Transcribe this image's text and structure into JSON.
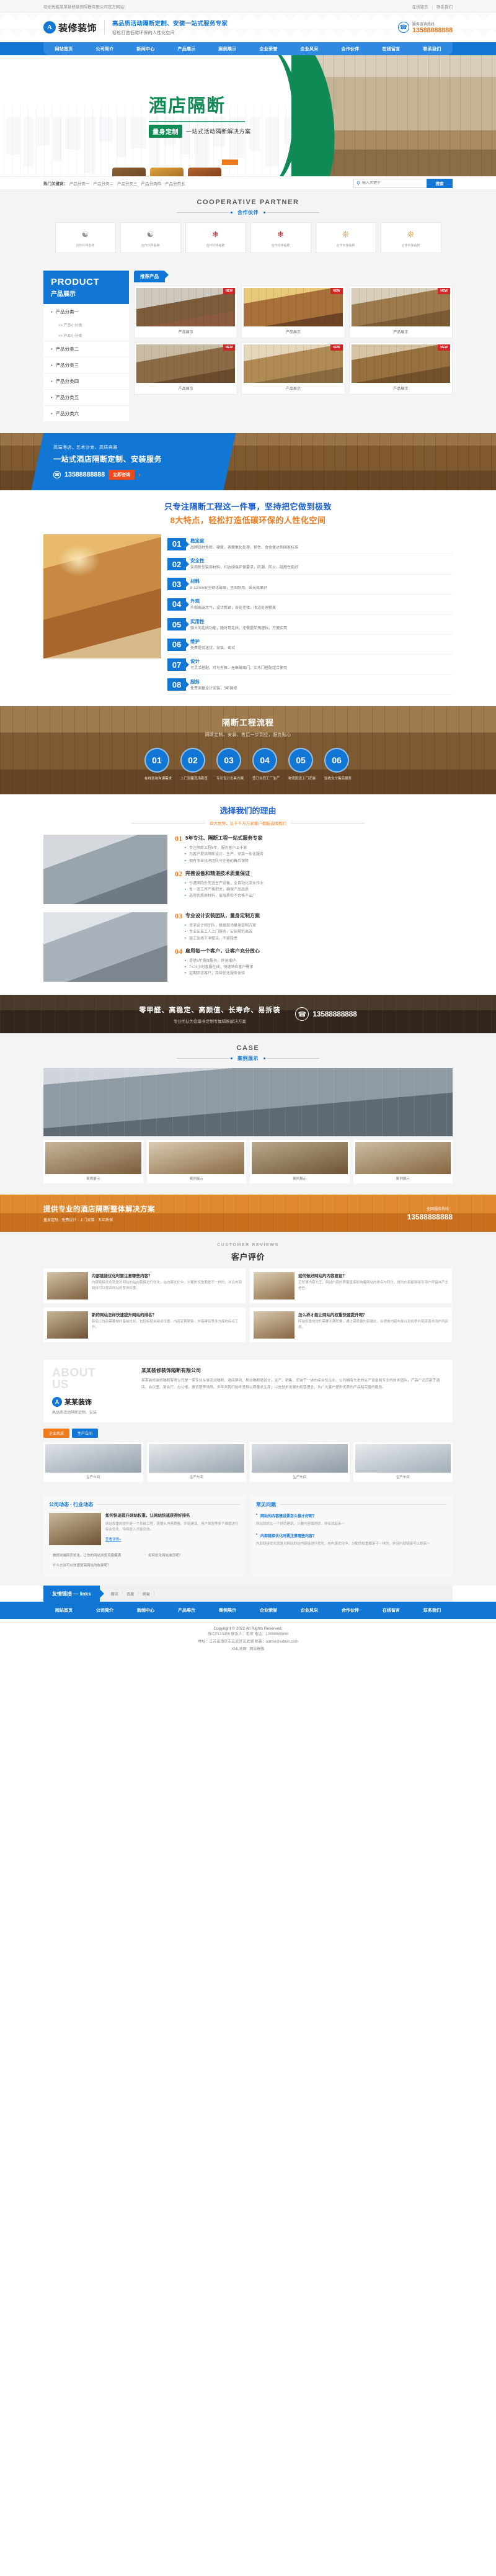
{
  "topbar": {
    "welcome": "欢迎光临某某装修装饰隔断有限公司官方网站！",
    "links": [
      {
        "label": "在线留言"
      },
      {
        "label": "联系我们"
      }
    ],
    "separator": "|"
  },
  "header": {
    "logo_mark": "A",
    "logo_text": "装修装饰",
    "slogan_main": "高品质活动隔断定制、安装一站式服务专家",
    "slogan_sub": "轻松打造低碳环保的人性化空间",
    "tel_label": "服务咨询热线",
    "tel_number": "13588888888",
    "phone_icon": "phone-icon",
    "accent_blue": "#1277d4",
    "accent_orange": "#ef7b1c"
  },
  "nav": {
    "items": [
      {
        "label": "网站首页"
      },
      {
        "label": "公司简介"
      },
      {
        "label": "新闻中心"
      },
      {
        "label": "产品展示"
      },
      {
        "label": "案例展示"
      },
      {
        "label": "企业荣誉"
      },
      {
        "label": "企业风采"
      },
      {
        "label": "合作伙伴"
      },
      {
        "label": "在线留言"
      },
      {
        "label": "联系我们"
      }
    ]
  },
  "hero": {
    "title": "酒店隔断",
    "badge": "量身定制",
    "subtitle": "一站式活动隔断解决方案",
    "accent_green": "#0f8a54"
  },
  "search": {
    "keywords_label": "热门关键词：",
    "keywords": [
      {
        "label": "产品分类一"
      },
      {
        "label": "产品分类二"
      },
      {
        "label": "产品分类三"
      },
      {
        "label": "产品分类四"
      },
      {
        "label": "产品分类五"
      }
    ],
    "placeholder": "输入关键字",
    "value": "",
    "button": "搜索",
    "search_icon": "search-icon"
  },
  "partners": {
    "en": "COOPERATIVE PARTNER",
    "cn": "合作伙伴",
    "items": [
      {
        "name": "合作伙伴名称",
        "mark": "gray"
      },
      {
        "name": "合作伙伴名称",
        "mark": "gray"
      },
      {
        "name": "合作伙伴名称",
        "mark": "red"
      },
      {
        "name": "合作伙伴名称",
        "mark": "red"
      },
      {
        "name": "合作伙伴名称",
        "mark": "gold"
      },
      {
        "name": "合作伙伴名称",
        "mark": "gold"
      }
    ]
  },
  "product": {
    "side_en": "PRODUCT",
    "side_cn": "产品展示",
    "categories": [
      {
        "label": "产品分类一",
        "subs": [
          {
            "label": ">> 产品小分类"
          },
          {
            "label": ">> 产品小分类"
          }
        ]
      },
      {
        "label": "产品分类二",
        "subs": []
      },
      {
        "label": "产品分类三",
        "subs": []
      },
      {
        "label": "产品分类四",
        "subs": []
      },
      {
        "label": "产品分类五",
        "subs": []
      },
      {
        "label": "产品分类六",
        "subs": []
      }
    ],
    "tab_label": "推荐产品",
    "new_tag": "NEW",
    "items": [
      {
        "caption": "产品展示"
      },
      {
        "caption": "产品展示"
      },
      {
        "caption": "产品展示"
      },
      {
        "caption": "产品展示"
      },
      {
        "caption": "产品展示"
      },
      {
        "caption": "产品展示"
      }
    ]
  },
  "cta1": {
    "line1": "高端酒店、艺术沙龙、高质典雅",
    "line2": "一站式酒店隔断定制、安装服务",
    "phone": "13588888888",
    "button": "立即咨询",
    "arrow": "›",
    "phone_icon": "phone-icon"
  },
  "features": {
    "title1": "只专注隔断工程这一件事，坚持把它做到极致",
    "title2": "8大特点，轻松打造低碳环保的人性化空间",
    "items": [
      {
        "num": "01",
        "title": "稳定度",
        "desc": "品牌铝材免检、硬度、表面氧化处理、韧性、合金量达到国家标准"
      },
      {
        "num": "02",
        "title": "安全性",
        "desc": "采用新型装饰材料，均达绿色环保要求，防潮、防火、阻燃性能好"
      },
      {
        "num": "03",
        "title": "材料",
        "desc": "5-12mm安全钢化玻璃，坚固耐用，采光效果好"
      },
      {
        "num": "04",
        "title": "外观",
        "desc": "外观高端大气，设计新颖，各处连接、收边处理精美"
      },
      {
        "num": "05",
        "title": "实用性",
        "desc": "强大的走线功能，随时可走线，无需提前预埋线，方便实用"
      },
      {
        "num": "06",
        "title": "维护",
        "desc": "免费提供送货、安装、调试"
      },
      {
        "num": "07",
        "title": "设计",
        "desc": "可灵活搭配，可与有框、无框玻璃门、实木门搭配组合使用"
      },
      {
        "num": "08",
        "title": "服务",
        "desc": "免费测量设计安装，5年保修"
      }
    ]
  },
  "process": {
    "title": "隔断工程流程",
    "subtitle": "隔断定制、安装、售后一步到位，服务贴心",
    "steps": [
      {
        "num": "01",
        "label": "在线咨询沟通需求"
      },
      {
        "num": "02",
        "label": "上门测量现场勘查"
      },
      {
        "num": "03",
        "label": "专业设计出具方案"
      },
      {
        "num": "04",
        "label": "签订合同工厂生产"
      },
      {
        "num": "05",
        "label": "物流配送上门安装"
      },
      {
        "num": "06",
        "label": "验收交付售后服务"
      }
    ]
  },
  "why": {
    "title": "选择我们的理由",
    "subtitle": "四大优势，让千千万万家客户都能选择我们",
    "blocks": [
      {
        "q": "01",
        "title": "5年专注、隔断工程一站式服务专家",
        "points": [
          "专注隔断工程5年，服务客户上千家",
          "为客户提供隔断设计、生产、安装一体化服务",
          "拥有专业技术团队与完善的售后保障"
        ]
      },
      {
        "q": "02",
        "title": "完善设备和精湛技术质量保证",
        "points": [
          "引进国内外先进生产设备，全自动化流水作业",
          "每一道工序严格把关，确保产品品质",
          "选用优质原材料，层层质检不合格不出厂"
        ]
      },
      {
        "q": "03",
        "title": "专业设计安装团队，量身定制方案",
        "points": [
          "资深设计师团队，根据现场量身定制方案",
          "专业安装工人上门服务，安装规范高效",
          "施工现场干净整洁，不留隐患"
        ]
      },
      {
        "q": "04",
        "title": "雇用每一个客户，让客户充分放心",
        "points": [
          "提供5年质保服务，终身维护",
          "7×24小时客服在线，快速响应客户需求",
          "定期回访客户，持续优化服务体验"
        ]
      }
    ]
  },
  "cta2": {
    "line1": "零甲醛、高稳定、高颜值、长寿命、易拆装",
    "line2": "专业团队为您量身定制专属隔断解决方案",
    "phone": "13588888888",
    "phone_icon": "phone-icon"
  },
  "case": {
    "en": "CASE",
    "cn": "案例展示",
    "items": [
      {
        "caption": "案例展示"
      },
      {
        "caption": "案例展示"
      },
      {
        "caption": "案例展示"
      },
      {
        "caption": "案例展示"
      }
    ]
  },
  "cta3": {
    "title": "提供专业的酒店隔断整体解决方案",
    "subtitle": "量身定制 · 免费设计 · 上门安装 · 五年质保",
    "tel_label": "全国服务热线：",
    "tel_number": "13588888888"
  },
  "testimonials": {
    "label": "CUSTOMER REVIEWS",
    "title": "客户评价",
    "items": [
      {
        "title": "内部链接优化时要注意哪些内容？",
        "desc": "内部链接优化就是对网站的站内链接进行优化，在内链优化中，分配的权重都是不一样的，并且内部链接可以提高网站的整体权重。"
      },
      {
        "title": "如何做好网站的内容建设？",
        "desc": "正所谓内容为王，网站内容的质量直接影响着网站的排名与转化，好的内容能够吸引用户停留并产生信任。"
      },
      {
        "title": "新的网站怎样快速提升网站的排名？",
        "desc": "新站上线后需要做好基础优化，包括标题关键词设置、内容定期更新、外链建设等多方面的综合工作。"
      },
      {
        "title": "怎么样才能让网站的权重快速提升呢？",
        "desc": "网站权重的提升需要长期积累，通过高质量内容输出、合理的内链布局以及优质外链资源共同作用实现。"
      }
    ]
  },
  "about": {
    "us_line1": "ABOUT",
    "us_line2": "US",
    "logo_mark": "A",
    "logo_text": "某某装饰",
    "tag": "高品质活动隔断定制、安装",
    "heading": "某某装修装饰隔断有限公司",
    "paragraph": "某某装修装饰隔断有限公司是一家专业从事活动隔断、酒店屏风、移动隔断墙设计、生产、销售、安装于一体的综合性企业。公司拥有先进的生产设备和专业的技术团队，产品广泛应用于酒店、会议室、宴会厅、办公楼、展览馆等场所。多年来我们始终坚持以质量求生存、以信誉求发展的经营理念，为广大客户提供优质的产品和完善的服务。",
    "tabs": [
      {
        "label": "企业风采"
      },
      {
        "label": "生产车间"
      }
    ],
    "gallery": [
      {
        "caption": "生产车间"
      },
      {
        "caption": "生产车间"
      },
      {
        "caption": "生产车间"
      },
      {
        "caption": "生产车间"
      }
    ]
  },
  "news": {
    "col1_title": "公司动态 · 行业动态",
    "col2_title": "常见问题",
    "article": {
      "title": "如何快速提升网站权重，让网站快速获得好排名",
      "desc": "网站权重的提升是一个系统工程，需要从内容质量、外链建设、用户体验等多个维度进行综合优化，持续投入才能见效。",
      "more": "查看详情+"
    },
    "links": [
      {
        "label": "做好前端网页优化，让你的网站浏览流量爆满"
      },
      {
        "label": "如何优化网站单页呢？"
      },
      {
        "label": "什么方法可以快速提高网站的收录呢？"
      }
    ],
    "faq_top": {
      "title": "网站的内容建设要怎么做才好呢？",
      "desc": "网站就好比一个好的建筑，只要内容填得好，排名就起来～"
    },
    "faq": {
      "question": "内部链接优化时要注意哪些内容？",
      "answer": "内部链接优化就是对网站的站内链接进行优化，在内链优化中，分配的权重都是不一样的，并且内部链接可以提高～"
    }
  },
  "friendlinks": {
    "tab": "友情链接 — links",
    "items": [
      {
        "label": "腾讯"
      },
      {
        "label": "百度"
      },
      {
        "label": "网易"
      }
    ],
    "separator": "|"
  },
  "footer": {
    "nav": [
      {
        "label": "网站首页"
      },
      {
        "label": "公司简介"
      },
      {
        "label": "新闻中心"
      },
      {
        "label": "产品展示"
      },
      {
        "label": "案例展示"
      },
      {
        "label": "企业荣誉"
      },
      {
        "label": "企业风采"
      },
      {
        "label": "合作伙伴"
      },
      {
        "label": "在线留言"
      },
      {
        "label": "联系我们"
      }
    ],
    "copyright": "Copyright © 2022 All Rights Reserved.",
    "icp_line": "苏ICP123456 联系人：老师 电话：13588888888",
    "addr_line": "地址：江苏省南京市玄武区玄武湖   邮箱：admin@admin.com",
    "map_links": [
      {
        "label": "XML地图"
      },
      {
        "label": "网站模板"
      }
    ]
  }
}
